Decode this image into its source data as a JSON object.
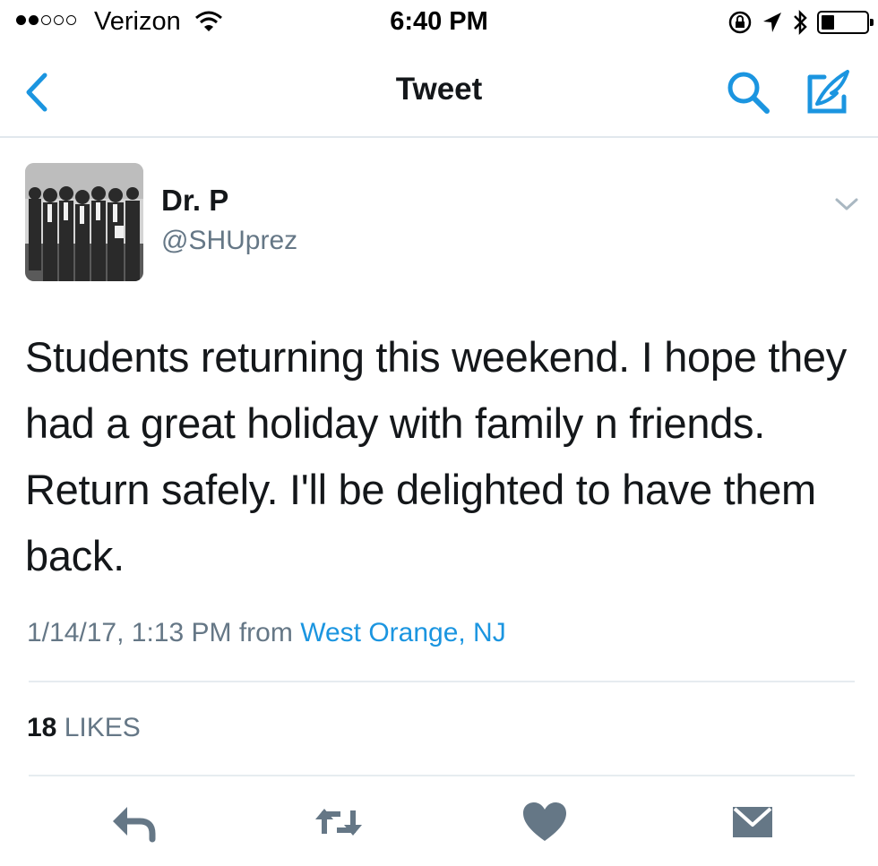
{
  "status_bar": {
    "carrier": "Verizon",
    "time": "6:40 PM",
    "icons": [
      "signal-dots-icon",
      "wifi-icon",
      "orientation-lock-icon",
      "location-arrow-icon",
      "bluetooth-icon",
      "battery-icon"
    ],
    "battery_level": 0.3
  },
  "nav": {
    "title": "Tweet",
    "back_icon": "chevron-left-icon",
    "search_icon": "search-icon",
    "compose_icon": "compose-tweet-icon",
    "accent_color": "#1b95e0"
  },
  "tweet": {
    "author_name": "Dr. P",
    "author_handle": "@SHUprez",
    "text": "Students returning this weekend. I hope they had a great holiday with family n friends. Return safely. I'll be delighted to have them back.",
    "timestamp": "1/14/17, 1:13 PM",
    "from_label": "from",
    "location": "West Orange, NJ",
    "likes_count": "18",
    "likes_label": "LIKES"
  },
  "actions": {
    "icons": [
      "reply-icon",
      "retweet-icon",
      "like-heart-icon",
      "direct-message-icon"
    ],
    "icon_color": "#657786"
  }
}
